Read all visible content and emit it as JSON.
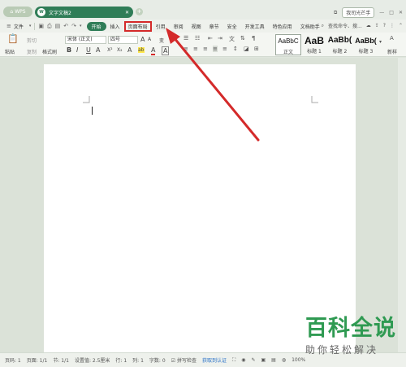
{
  "titlebar": {
    "wps_tab": "WPS",
    "doc_tab_icon": "W",
    "doc_tab_name": "文字文稿2",
    "add_tab": "+",
    "login": "我司光芒手",
    "win_minimize": "—",
    "win_maximize": "□",
    "win_close": "✕"
  },
  "menubar": {
    "file": "文件",
    "tabs": [
      "开始",
      "插入",
      "页面布局",
      "引用",
      "审阅",
      "视图",
      "章节",
      "安全",
      "开发工具",
      "特色应用",
      "文档助手"
    ],
    "active_tab": "开始",
    "highlighted_tab": "页面布局",
    "search": "查找命令、搜..."
  },
  "ribbon": {
    "paste": "粘贴",
    "cut": "剪切",
    "copy": "复制",
    "format_painter": "格式刷",
    "font_name": "宋体 (正文)",
    "font_size": "四号",
    "font_grow": "A",
    "font_shrink": "A",
    "clear_format": "变",
    "bold": "B",
    "italic": "I",
    "underline": "U",
    "strike": "A",
    "superscript": "X²",
    "subscript": "X₂",
    "text_effect": "A",
    "highlight": "ab",
    "font_color": "A",
    "char_border": "A",
    "styles": [
      {
        "sample": "AaBbC",
        "name": "正文"
      },
      {
        "sample": "AaB",
        "name": "标题 1"
      },
      {
        "sample": "AaBb(",
        "name": "标题 2"
      },
      {
        "sample": "AaBb(",
        "name": "标题 3"
      }
    ],
    "new_style": "新样"
  },
  "statusbar": {
    "page_no": "页码: 1",
    "pages": "页面: 1/1",
    "section": "节: 1/1",
    "setting": "设置值: 2.5厘米",
    "row": "行: 1",
    "col": "列: 1",
    "words": "字数: 0",
    "spell": "拼写检查",
    "auth": "获取到认证",
    "zoom": "100%"
  },
  "watermark": {
    "line1": "百科全说",
    "line2": "助你轻松解决"
  },
  "colors": {
    "accent": "#2f7d57",
    "arrow": "#d42a2a",
    "watermark": "#2f9a52"
  }
}
